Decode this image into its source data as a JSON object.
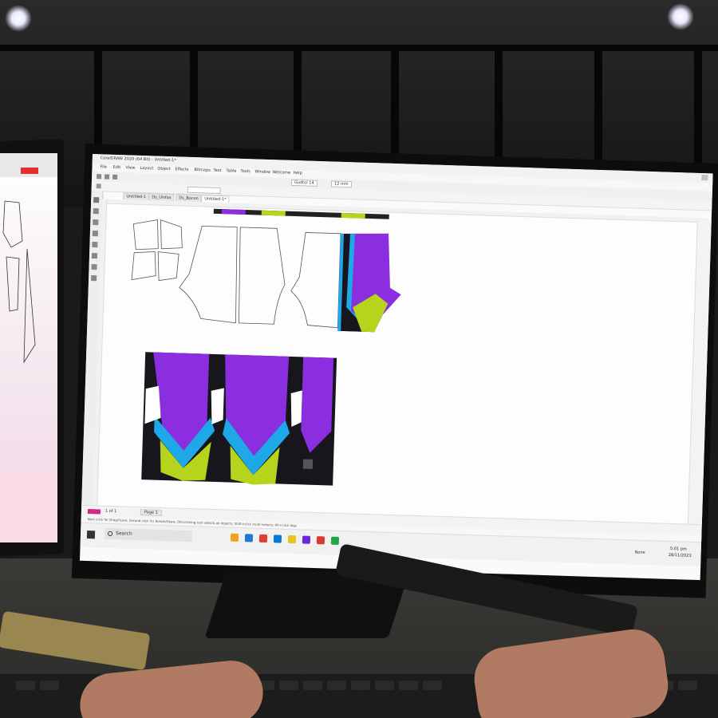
{
  "app": {
    "title": "CorelDRAW 2020 (64 Bit) - Untitled-1*",
    "menu": [
      "File",
      "Edit",
      "View",
      "Layout",
      "Object",
      "Effects",
      "Bitmaps",
      "Text",
      "Table",
      "Tools",
      "Window",
      "Welcome",
      "Help"
    ],
    "tabs": [
      "Untitled-1",
      "Ds_Uisfas",
      "Ds_Bocon",
      "Untitled-1*"
    ],
    "font_name": "Gudtol 14",
    "zoom_label": "12 mm",
    "page_tab": "Page 1",
    "page_indicator": "1 of 1",
    "status_hint": "Next click for Drag/Scale; Second click for Rotate/Skew; Dbl-clicking tool selects all objects; Shift+click multi-selects; Alt+click digs",
    "status_right": "None"
  },
  "taskbar": {
    "search_placeholder": "Search",
    "time": "5:01 pm",
    "date": "28/11/2023",
    "icon_colors": [
      "#f0a21c",
      "#1f77d6",
      "#e53b2e",
      "#0a78d7",
      "#e8c41f",
      "#6a2ad7",
      "#d83933",
      "#1ea84a"
    ]
  },
  "colors": {
    "purple": "#8a2ee0",
    "purple_light": "#b45cf2",
    "blue": "#1fa8e8",
    "lime": "#b6d41c",
    "black": "#16161c"
  }
}
